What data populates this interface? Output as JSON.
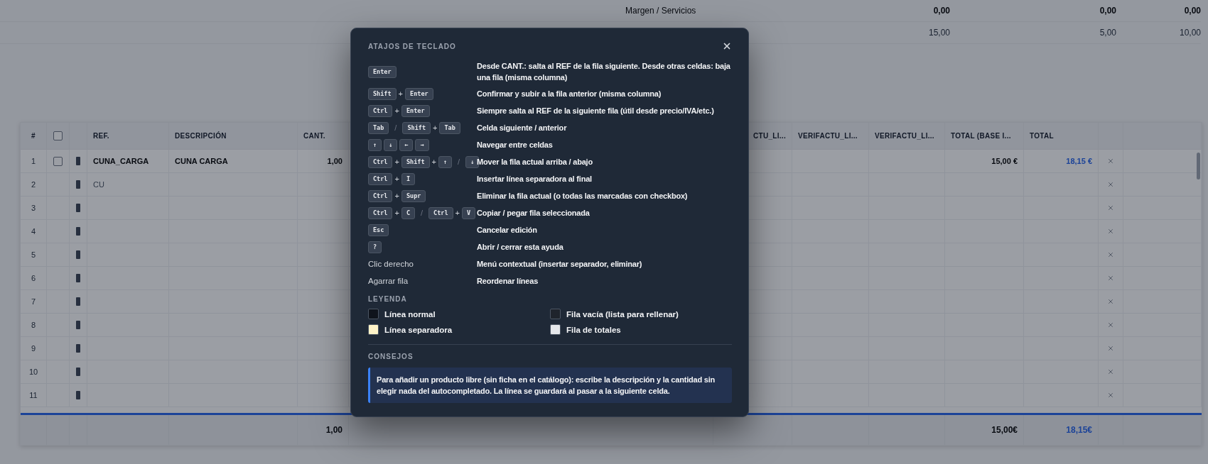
{
  "summary": {
    "label": "Margen / Servicios",
    "rows": [
      {
        "kind": "strong",
        "values": [
          "0,00",
          "0,00",
          "0,00"
        ]
      },
      {
        "kind": "muted",
        "values": [
          "15,00",
          "5,00",
          "10,00"
        ]
      }
    ]
  },
  "table": {
    "header_checkbox": {
      "checked": false
    },
    "columns": [
      "#",
      "REF.",
      "DESCRIPCIÓN",
      "CANT.",
      "CTU_LI...",
      "VERIFACTU_LI...",
      "VERIFACTU_LI...",
      "TOTAL (BASE I...",
      "TOTAL"
    ],
    "rows": [
      {
        "number": "1",
        "kind": "item",
        "checked": false,
        "ref": "CUNA_CARGA",
        "description": "CUNA CARGA",
        "quantity": "1,00",
        "total_base": "15,00 €",
        "total": "18,15 €"
      },
      {
        "number": "2",
        "kind": "draft",
        "ref": "CU"
      },
      {
        "number": "3",
        "kind": "empty"
      },
      {
        "number": "4",
        "kind": "empty"
      },
      {
        "number": "5",
        "kind": "empty"
      },
      {
        "number": "6",
        "kind": "empty"
      },
      {
        "number": "7",
        "kind": "empty"
      },
      {
        "number": "8",
        "kind": "empty"
      },
      {
        "number": "9",
        "kind": "empty"
      },
      {
        "number": "10",
        "kind": "empty"
      },
      {
        "number": "11",
        "kind": "empty"
      }
    ],
    "totals": {
      "quantity": "1,00",
      "total_base": "15,00€",
      "total": "18,15€"
    }
  },
  "dialog": {
    "title": "ATAJOS DE TECLADO",
    "shortcuts": [
      {
        "keys": [
          {
            "kind": "key",
            "text": "Enter"
          }
        ],
        "description": "Desde CANT.: salta al REF de la fila siguiente. Desde otras celdas: baja una fila (misma columna)"
      },
      {
        "keys": [
          {
            "kind": "key",
            "text": "Shift"
          },
          {
            "kind": "sep",
            "text": "+"
          },
          {
            "kind": "key",
            "text": "Enter"
          }
        ],
        "description": "Confirmar y subir a la fila anterior (misma columna)"
      },
      {
        "keys": [
          {
            "kind": "key",
            "text": "Ctrl"
          },
          {
            "kind": "sep",
            "text": "+"
          },
          {
            "kind": "key",
            "text": "Enter"
          }
        ],
        "description": "Siempre salta al REF de la siguiente fila (útil desde precio/IVA/etc.)"
      },
      {
        "keys": [
          {
            "kind": "key",
            "text": "Tab"
          },
          {
            "kind": "slash",
            "text": "/"
          },
          {
            "kind": "key",
            "text": "Shift"
          },
          {
            "kind": "sep",
            "text": "+"
          },
          {
            "kind": "key",
            "text": "Tab"
          }
        ],
        "description": "Celda siguiente / anterior"
      },
      {
        "keys": [
          {
            "kind": "key",
            "text": "↑"
          },
          {
            "kind": "key",
            "text": "↓"
          },
          {
            "kind": "key",
            "text": "←"
          },
          {
            "kind": "key",
            "text": "→"
          }
        ],
        "description": "Navegar entre celdas"
      },
      {
        "keys": [
          {
            "kind": "key",
            "text": "Ctrl"
          },
          {
            "kind": "sep",
            "text": "+"
          },
          {
            "kind": "key",
            "text": "Shift"
          },
          {
            "kind": "sep",
            "text": "+"
          },
          {
            "kind": "key",
            "text": "↑"
          },
          {
            "kind": "slash",
            "text": "/"
          },
          {
            "kind": "key",
            "text": "↓"
          }
        ],
        "description": "Mover la fila actual arriba / abajo"
      },
      {
        "keys": [
          {
            "kind": "key",
            "text": "Ctrl"
          },
          {
            "kind": "sep",
            "text": "+"
          },
          {
            "kind": "key",
            "text": "I"
          }
        ],
        "description": "Insertar línea separadora al final"
      },
      {
        "keys": [
          {
            "kind": "key",
            "text": "Ctrl"
          },
          {
            "kind": "sep",
            "text": "+"
          },
          {
            "kind": "key",
            "text": "Supr"
          }
        ],
        "description": "Eliminar la fila actual (o todas las marcadas con checkbox)"
      },
      {
        "keys": [
          {
            "kind": "key",
            "text": "Ctrl"
          },
          {
            "kind": "sep",
            "text": "+"
          },
          {
            "kind": "key",
            "text": "C"
          },
          {
            "kind": "slash",
            "text": "/"
          },
          {
            "kind": "key",
            "text": "Ctrl"
          },
          {
            "kind": "sep",
            "text": "+"
          },
          {
            "kind": "key",
            "text": "V"
          }
        ],
        "description": "Copiar / pegar fila seleccionada"
      },
      {
        "keys": [
          {
            "kind": "key",
            "text": "Esc"
          }
        ],
        "description": "Cancelar edición"
      },
      {
        "keys": [
          {
            "kind": "key",
            "text": "?"
          }
        ],
        "description": "Abrir / cerrar esta ayuda"
      },
      {
        "keys": [
          {
            "kind": "text",
            "text": "Clic derecho"
          }
        ],
        "description": "Menú contextual (insertar separador, eliminar)"
      },
      {
        "keys": [
          {
            "kind": "text",
            "text": "Agarrar fila"
          }
        ],
        "description": "Reordenar líneas"
      }
    ],
    "legend_title": "LEYENDA",
    "legend": [
      {
        "label": "Línea normal",
        "color": "#0f141c"
      },
      {
        "label": "Fila vacía (lista para rellenar)",
        "color": "#1f242c"
      },
      {
        "label": "Línea separadora",
        "color": "#fef3c7"
      },
      {
        "label": "Fila de totales",
        "color": "#e5e7eb"
      }
    ],
    "tips_title": "CONSEJOS",
    "tip": "Para añadir un producto libre (sin ficha en el catálogo): escribe la descripción y la cantidad sin elegir nada del autocompletado. La línea se guardará al pasar a la siguiente celda."
  }
}
